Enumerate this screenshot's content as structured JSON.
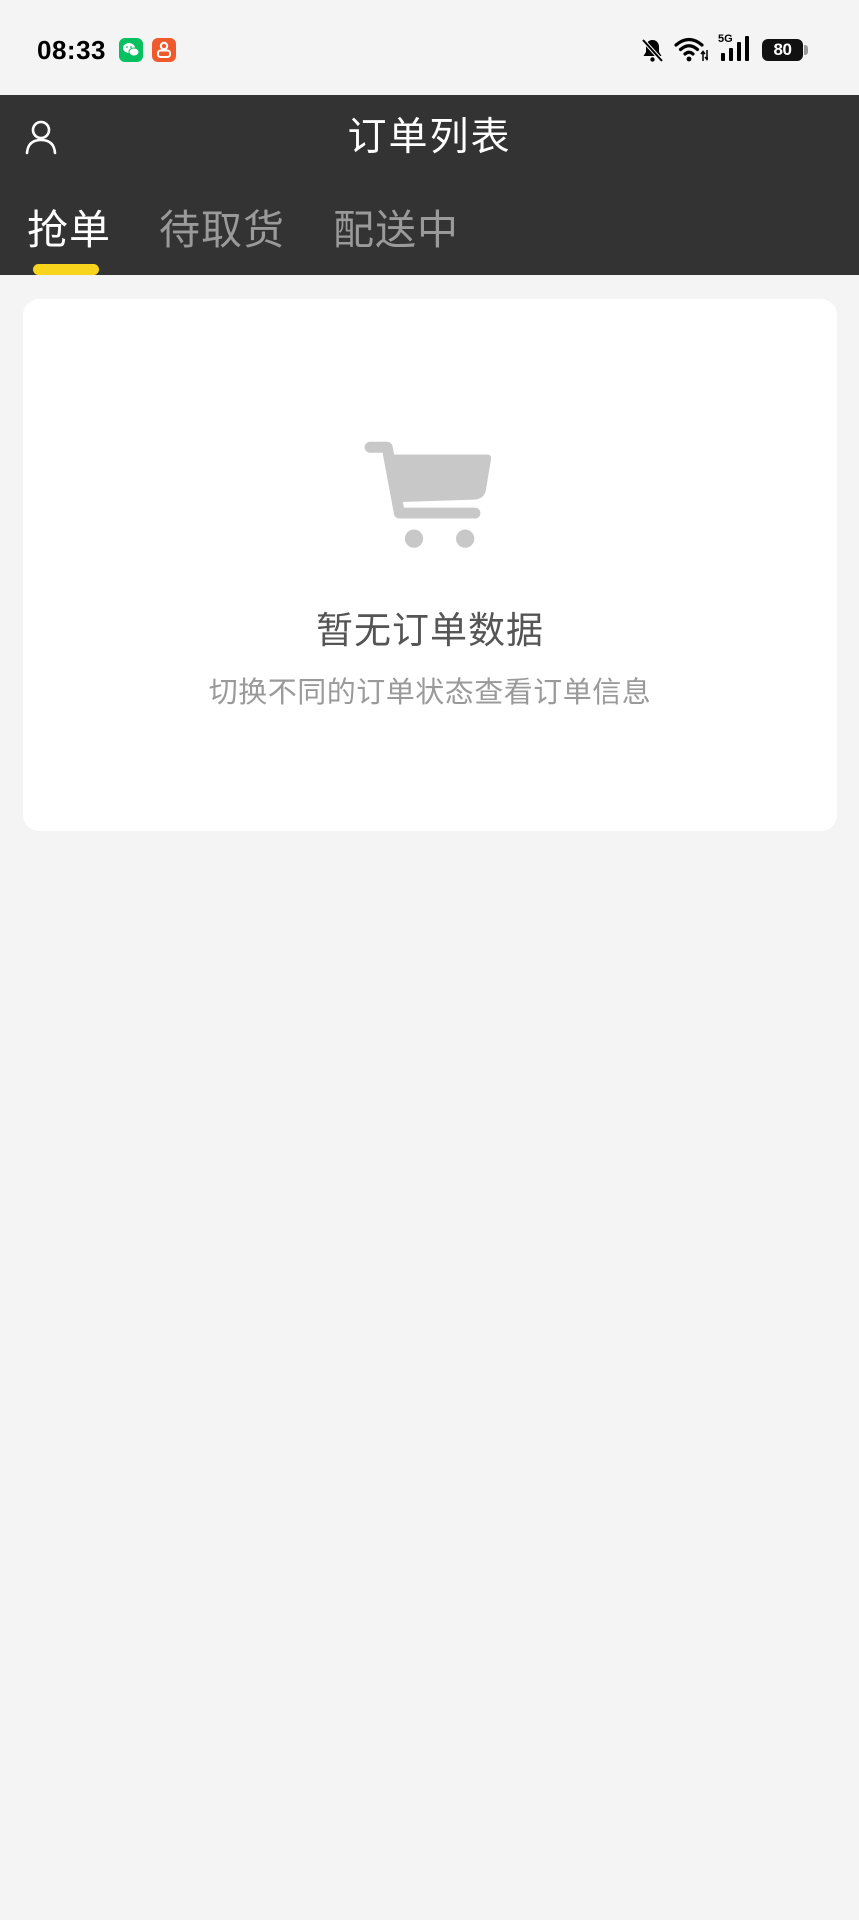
{
  "status_bar": {
    "time": "08:33",
    "network": "5G",
    "battery": "80",
    "notification_icons": [
      "wechat-icon",
      "orange-app-icon"
    ],
    "system_icons": [
      "mute-icon",
      "wifi-icon",
      "signal-icon",
      "battery-icon"
    ]
  },
  "header": {
    "title": "订单列表",
    "left_icon": "user-icon"
  },
  "tabs": [
    {
      "label": "抢单",
      "active": true
    },
    {
      "label": "待取货",
      "active": false
    },
    {
      "label": "配送中",
      "active": false
    }
  ],
  "empty_state": {
    "icon": "cart-icon",
    "title": "暂无订单数据",
    "subtitle": "切换不同的订单状态查看订单信息"
  },
  "colors": {
    "header_bg": "#333333",
    "accent": "#f9d41c",
    "page_bg": "#f4f4f4",
    "card_bg": "#ffffff",
    "icon_gray": "#c8c8c8"
  }
}
